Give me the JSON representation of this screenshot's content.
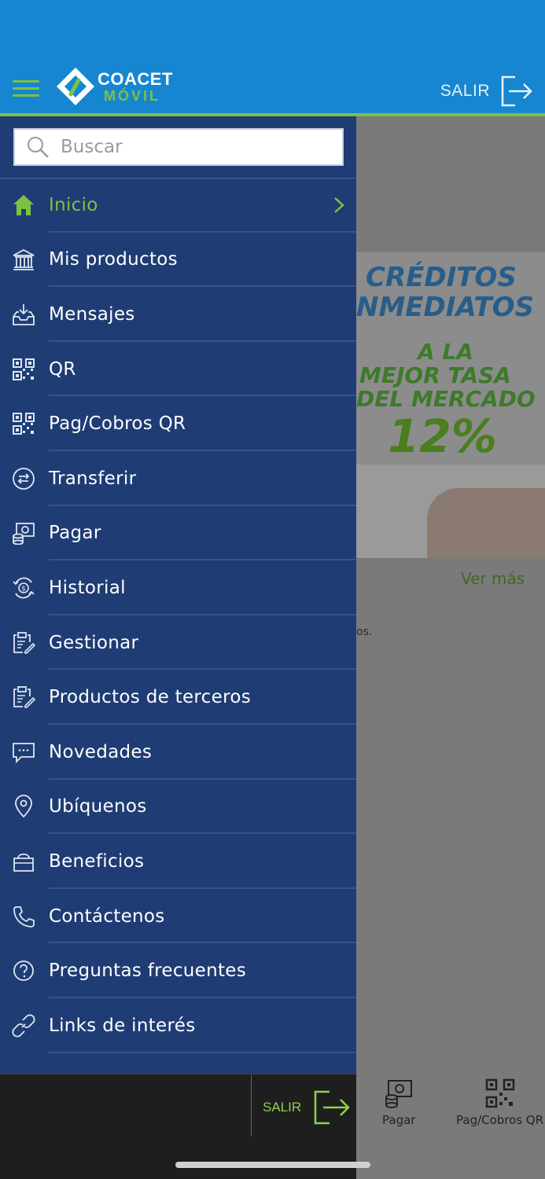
{
  "header": {
    "logo_top": "COACET",
    "logo_bottom": "MÓVIL",
    "exit_label": "SALIR"
  },
  "search": {
    "placeholder": "Buscar"
  },
  "menu": {
    "items": [
      {
        "label": "Inicio",
        "icon": "home-icon",
        "active": true
      },
      {
        "label": "Mis productos",
        "icon": "bank-icon"
      },
      {
        "label": "Mensajes",
        "icon": "inbox-icon"
      },
      {
        "label": "QR",
        "icon": "qr-icon"
      },
      {
        "label": "Pag/Cobros QR",
        "icon": "qr-icon"
      },
      {
        "label": "Transferir",
        "icon": "transfer-icon"
      },
      {
        "label": "Pagar",
        "icon": "pay-icon"
      },
      {
        "label": "Historial",
        "icon": "history-icon"
      },
      {
        "label": "Gestionar",
        "icon": "clipboard-icon"
      },
      {
        "label": "Productos de terceros",
        "icon": "clipboard-icon"
      },
      {
        "label": "Novedades",
        "icon": "chat-icon"
      },
      {
        "label": "Ubíquenos",
        "icon": "location-icon"
      },
      {
        "label": "Beneficios",
        "icon": "bag-icon"
      },
      {
        "label": "Contáctenos",
        "icon": "phone-icon"
      },
      {
        "label": "Preguntas frecuentes",
        "icon": "question-icon"
      },
      {
        "label": "Links de interés",
        "icon": "link-icon"
      }
    ]
  },
  "background": {
    "promo": {
      "line1": "CRÉDITOS",
      "line2": "NMEDIATOS",
      "line3": "A LA",
      "line4": "MEJOR TASA",
      "line5": "DEL MERCADO",
      "line6": "12%"
    },
    "ver_mas": "Ver más",
    "snippet": "os."
  },
  "bottom": {
    "exit_label": "SALIR",
    "tabs": [
      {
        "label": "Pagar",
        "icon": "pay-icon"
      },
      {
        "label": "Pag/Cobros QR",
        "icon": "qr-icon"
      }
    ]
  },
  "colors": {
    "header_blue": "#1786d0",
    "accent_green": "#7cc242",
    "drawer_navy": "#1f3c74"
  }
}
